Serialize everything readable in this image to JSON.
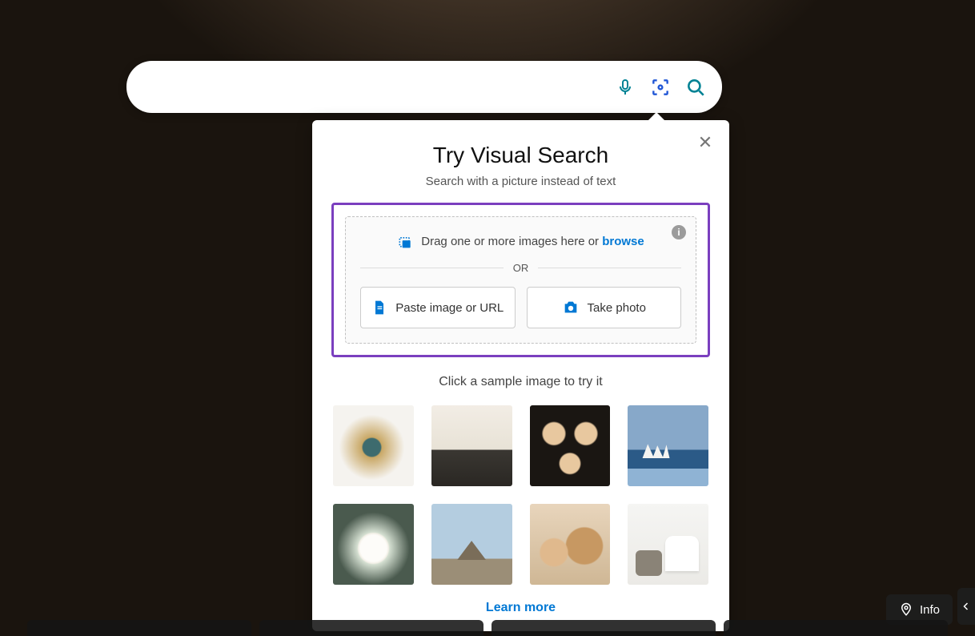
{
  "search": {
    "placeholder": ""
  },
  "popover": {
    "title": "Try Visual Search",
    "subtitle": "Search with a picture instead of text",
    "drop_text": "Drag one or more images here or ",
    "browse": "browse",
    "or": "OR",
    "paste_btn": "Paste image or URL",
    "photo_btn": "Take photo",
    "sample_text": "Click a sample image to try it",
    "learn_more": "Learn more"
  },
  "footer": {
    "info": "Info"
  }
}
